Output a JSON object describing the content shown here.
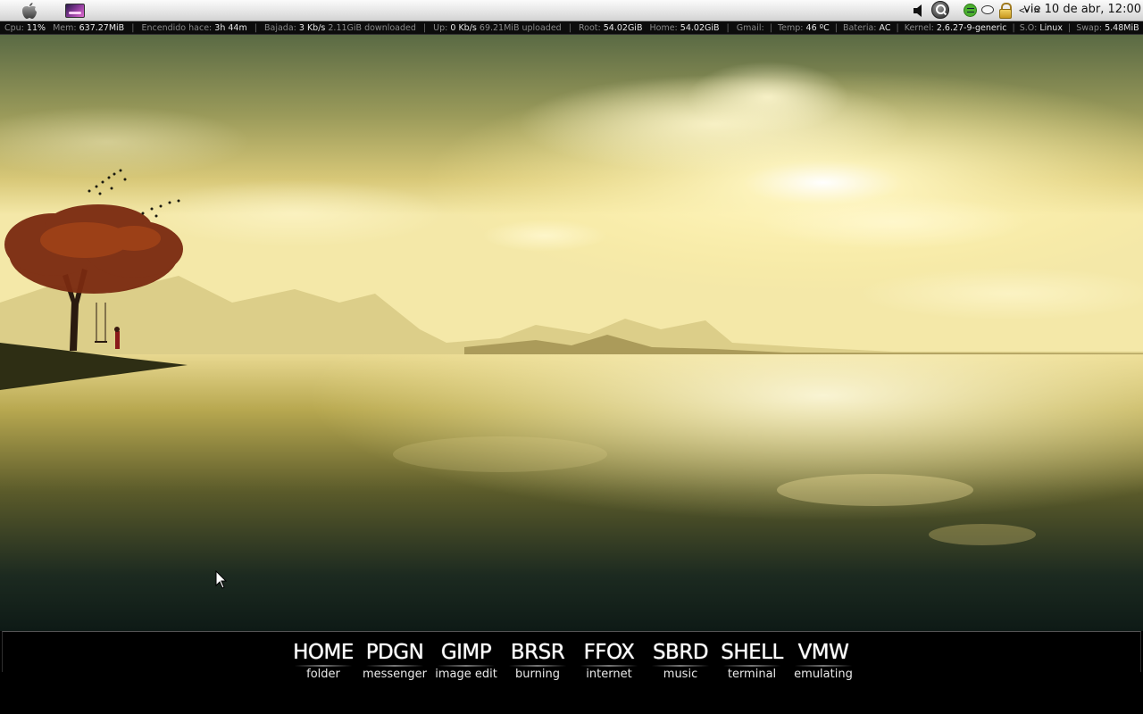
{
  "menubar": {
    "apple_icon": "apple-logo-icon",
    "launcher_icon": "desktop-switcher-icon",
    "tray_icons": [
      "volume-icon",
      "search-icon",
      "spotify-icon",
      "chat-icon",
      "lock-icon",
      "network-icon"
    ],
    "network_glyph": "<··>",
    "clock": "vie 10 de abr, 12:00"
  },
  "statusbar": {
    "cpu": {
      "label": "Cpu:",
      "value": "11%"
    },
    "mem": {
      "label": "Mem:",
      "value": "637.27MiB"
    },
    "uptime": {
      "label": "Encendido hace:",
      "value": "3h 44m"
    },
    "down": {
      "label": "Bajada:",
      "value": "3 Kb/s",
      "extra": "2.11GiB downloaded"
    },
    "up": {
      "label": "Up:",
      "value": "0 Kb/s",
      "extra": "69.21MiB uploaded"
    },
    "root": {
      "label": "Root:",
      "value": "54.02GiB"
    },
    "home": {
      "label": "Home:",
      "value": "54.02GiB"
    },
    "gmail": {
      "label": "Gmail:",
      "value": ""
    },
    "temp": {
      "label": "Temp:",
      "value": "46 ºC"
    },
    "battery": {
      "label": "Bateria:",
      "value": "AC"
    },
    "kernel": {
      "label": "Kernel:",
      "value": "2.6.27-9-generic"
    },
    "os": {
      "label": "S.O:",
      "value": "Linux"
    },
    "swap": {
      "label": "Swap:",
      "value": "5.48MiB"
    },
    "separator": "|"
  },
  "dock": {
    "launchers": [
      {
        "title": "HOME",
        "sub": "folder"
      },
      {
        "title": "PDGN",
        "sub": "messenger"
      },
      {
        "title": "GIMP",
        "sub": "image edit"
      },
      {
        "title": "BRSR",
        "sub": "burning"
      },
      {
        "title": "FFOX",
        "sub": "internet"
      },
      {
        "title": "SBRD",
        "sub": "music"
      },
      {
        "title": "SHELL",
        "sub": "terminal"
      },
      {
        "title": "VMW",
        "sub": "emulating"
      }
    ]
  },
  "colors": {
    "sky_top": "#4a5a3a",
    "sky_glow": "#fff6c0",
    "water_dark": "#0e1a16",
    "dock_bg": "#000000",
    "statusbar_bg": "#0c0c0c"
  }
}
